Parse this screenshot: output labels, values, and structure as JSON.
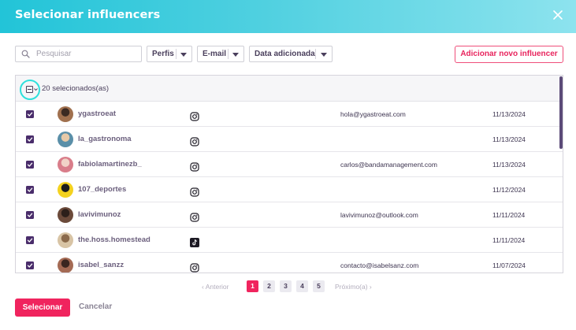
{
  "modal": {
    "title": "Selecionar influencers"
  },
  "filters": {
    "search_placeholder": "Pesquisar",
    "profiles_label": "Perfis",
    "email_label": "E-mail",
    "date_label": "Data adicionada",
    "add_button": "Adicionar novo influencer"
  },
  "table": {
    "selected_text": "20 selecionados(as)",
    "rows": [
      {
        "username": "ygastroeat",
        "network": "instagram-icon",
        "email": "hola@ygastroeat.com",
        "date": "11/13/2024",
        "checked": true
      },
      {
        "username": "la_gastronoma",
        "network": "instagram-icon",
        "email": "",
        "date": "11/13/2024",
        "checked": true
      },
      {
        "username": "fabiolamartinezb_",
        "network": "instagram-icon",
        "email": "carlos@bandamanagement.com",
        "date": "11/13/2024",
        "checked": true
      },
      {
        "username": "107_deportes",
        "network": "instagram-icon",
        "email": "",
        "date": "11/12/2024",
        "checked": true
      },
      {
        "username": "lavivimunoz",
        "network": "instagram-icon",
        "email": "lavivimunoz@outlook.com",
        "date": "11/11/2024",
        "checked": true
      },
      {
        "username": "the.hoss.homestead",
        "network": "tiktok-icon",
        "email": "",
        "date": "11/11/2024",
        "checked": true
      },
      {
        "username": "isabel_sanzz",
        "network": "instagram-icon",
        "email": "contacto@isabelsanz.com",
        "date": "11/07/2024",
        "checked": true
      }
    ]
  },
  "pagination": {
    "prev": "‹ Anterior",
    "pages": [
      "1",
      "2",
      "3",
      "4",
      "5"
    ],
    "current_page": "1",
    "next": "Próximo(a) ›"
  },
  "footer": {
    "select_button": "Selecionar",
    "cancel_button": "Cancelar"
  },
  "colors": {
    "header_from": "#22c4d8",
    "header_to": "#8de3ee",
    "accent": "#f0245e",
    "checkbox": "#4a2d6b",
    "focus_ring": "#2ee0dc"
  }
}
